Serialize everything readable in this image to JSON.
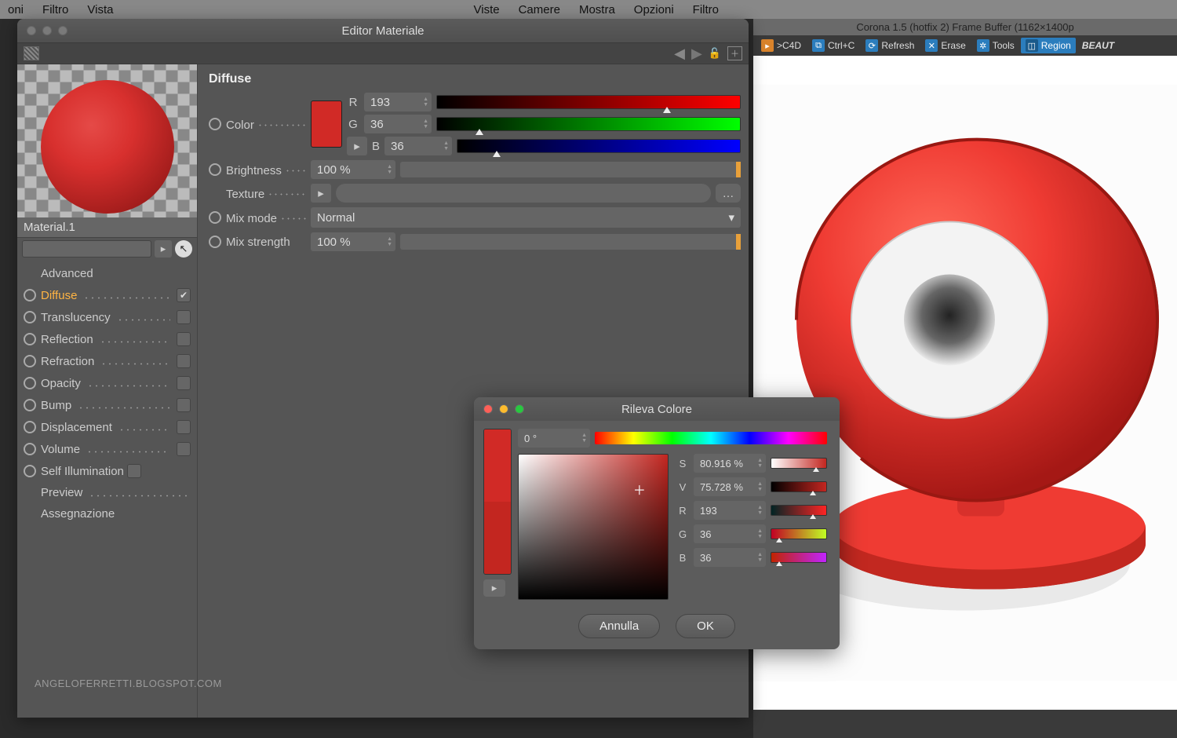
{
  "menu": {
    "items": [
      "oni",
      "Filtro",
      "Vista",
      "Viste",
      "Camere",
      "Mostra",
      "Opzioni",
      "Filtro"
    ]
  },
  "framebuffer": {
    "title": "Corona 1.5 (hotfix 2) Frame Buffer (1162×1400p",
    "buttons": {
      "c4d": ">C4D",
      "ctrlc": "Ctrl+C",
      "refresh": "Refresh",
      "erase": "Erase",
      "tools": "Tools",
      "region": "Region",
      "beauty": "BEAUT"
    }
  },
  "editor": {
    "title": "Editor Materiale",
    "material_name": "Material.1",
    "channels": {
      "advanced": "Advanced",
      "diffuse": "Diffuse",
      "translucency": "Translucency",
      "reflection": "Reflection",
      "refraction": "Refraction",
      "opacity": "Opacity",
      "bump": "Bump",
      "displacement": "Displacement",
      "volume": "Volume",
      "self_illumination": "Self Illumination",
      "preview": "Preview",
      "assegnazione": "Assegnazione"
    },
    "diffuse": {
      "section": "Diffuse",
      "color_label": "Color",
      "r_label": "R",
      "r_value": "193",
      "g_label": "G",
      "g_value": "36",
      "b_label": "B",
      "b_value": "36",
      "brightness_label": "Brightness",
      "brightness_value": "100 %",
      "texture_label": "Texture",
      "mixmode_label": "Mix mode",
      "mixmode_value": "Normal",
      "mixstrength_label": "Mix strength",
      "mixstrength_value": "100 %"
    }
  },
  "picker": {
    "title": "Rileva Colore",
    "hue": "0 °",
    "s_label": "S",
    "s_value": "80.916 %",
    "v_label": "V",
    "v_value": "75.728 %",
    "r_label": "R",
    "r_value": "193",
    "g_label": "G",
    "g_value": "36",
    "b_label": "B",
    "b_value": "36",
    "cancel": "Annulla",
    "ok": "OK",
    "swatch": "#c32620"
  },
  "watermark": "ANGELOFERRETTI.BLOGSPOT.COM"
}
